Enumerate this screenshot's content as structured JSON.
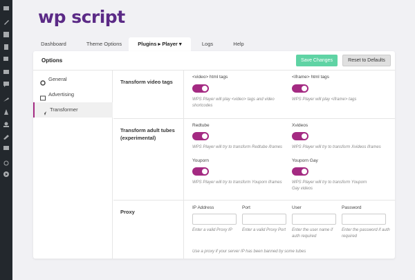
{
  "logo": {
    "text": "wp script"
  },
  "sidebar_icons": [
    "dashboard-icon",
    "posts-icon",
    "media-icon",
    "pages-icon",
    "comments-icon",
    "appearance-icon",
    "plugins-icon",
    "users-icon",
    "tools-icon",
    "settings-icon",
    "collapse-icon",
    "play-icon"
  ],
  "tabs": [
    {
      "label": "Dashboard"
    },
    {
      "label": "Theme Options"
    },
    {
      "label": "Plugins  ▸  Player  ▾"
    },
    {
      "label": "Logs"
    },
    {
      "label": "Help"
    }
  ],
  "panel": {
    "title": "Options",
    "save_label": "Save Changes",
    "reset_label": "Reset to Defaults",
    "colors": {
      "save": "#5fd3a4",
      "accent": "#a42a82",
      "brand": "#5b2a86"
    }
  },
  "side_menu": [
    {
      "label": "General",
      "icon": "gear-icon"
    },
    {
      "label": "Advertising",
      "icon": "ad-icon"
    },
    {
      "label": "Transformer",
      "icon": "rocket-icon"
    }
  ],
  "sections": {
    "video_tags": {
      "label": "Transform video tags",
      "fields": [
        {
          "label": "<video> html tags",
          "help": "WPS Player will play <video> tags and video shortcodes",
          "on": true
        },
        {
          "label": "<iframe> html tags",
          "help": "WPS Player will play <iframe> tags",
          "on": true
        }
      ]
    },
    "adult_tubes": {
      "label": "Transform adult tubes (experimental)",
      "fields": [
        {
          "label": "Redtube",
          "help": "WPS Player will try to transform Redtube iframes",
          "on": true
        },
        {
          "label": "Xvideos",
          "help": "WPS Player will try to transform Xvideos iframes",
          "on": true
        },
        {
          "label": "Youporn",
          "help": "WPS Player will try to transform Youporn iframes",
          "on": true
        },
        {
          "label": "Youporn Gay",
          "help": "WPS Player will try to transform Youporn Gay videos",
          "on": true
        }
      ]
    },
    "proxy": {
      "label": "Proxy",
      "fields": [
        {
          "label": "IP Address",
          "help": "Enter a valid Proxy IP",
          "value": ""
        },
        {
          "label": "Port",
          "help": "Enter a valid Proxy Port",
          "value": ""
        },
        {
          "label": "User",
          "help": "Enter the user name if auth required",
          "value": ""
        },
        {
          "label": "Password",
          "help": "Enter the password if auth required",
          "value": ""
        }
      ],
      "note": "Use a proxy if your server IP has been banned by some tubes"
    }
  }
}
